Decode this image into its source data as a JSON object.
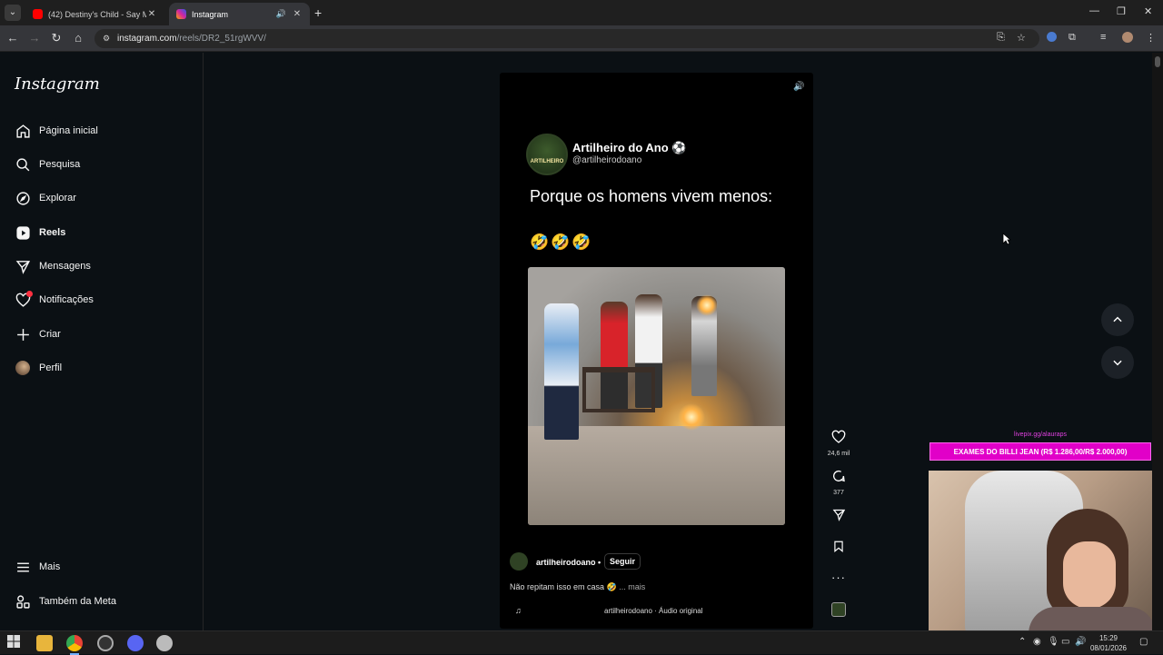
{
  "browser": {
    "tabs": [
      {
        "title": "(42) Destiny's Child - Say My Name",
        "favicon_color": "#ff0000",
        "active": false
      },
      {
        "title": "Instagram",
        "favicon_color": "#d6249f",
        "active": true
      }
    ],
    "url_host": "instagram.com",
    "url_path": "/reels/DR2_51rgWVV/"
  },
  "sidebar": {
    "logo": "Instagram",
    "items": [
      {
        "label": "Página inicial",
        "icon": "home-icon"
      },
      {
        "label": "Pesquisa",
        "icon": "search-icon"
      },
      {
        "label": "Explorar",
        "icon": "compass-icon"
      },
      {
        "label": "Reels",
        "icon": "reels-icon"
      },
      {
        "label": "Mensagens",
        "icon": "messenger-icon"
      },
      {
        "label": "Notificações",
        "icon": "heart-icon"
      },
      {
        "label": "Criar",
        "icon": "plus-icon"
      },
      {
        "label": "Perfil",
        "icon": "profile-avatar-icon"
      },
      {
        "label": "Mais",
        "icon": "menu-icon"
      },
      {
        "label": "Também da Meta",
        "icon": "meta-apps-icon"
      }
    ]
  },
  "reel": {
    "account_badge": "ARTILHEIRO",
    "account_name": "Artilheiro do Ano ⚽",
    "account_handle": "@artilheirodoano",
    "headline": "Porque os homens vivem menos:",
    "emojis": "🤣🤣🤣",
    "username": "artilheirodoano",
    "follow_label": "Seguir",
    "caption": "Não repitam isso em casa 🤣",
    "more_label": "... mais",
    "audio": "artilheirodoano · Áudio original",
    "likes": "24,6 mil",
    "comments": "377"
  },
  "overlay": {
    "link": "livepix.gg/alauraps",
    "banner": "EXAMES DO BILLI JEAN (R$ 1.286,00/R$ 2.000,00)"
  },
  "taskbar": {
    "time": "15:29",
    "date": "08/01/2026"
  },
  "colors": {
    "ig_background": "#0b1014",
    "overlay_pink": "#e100c8"
  }
}
